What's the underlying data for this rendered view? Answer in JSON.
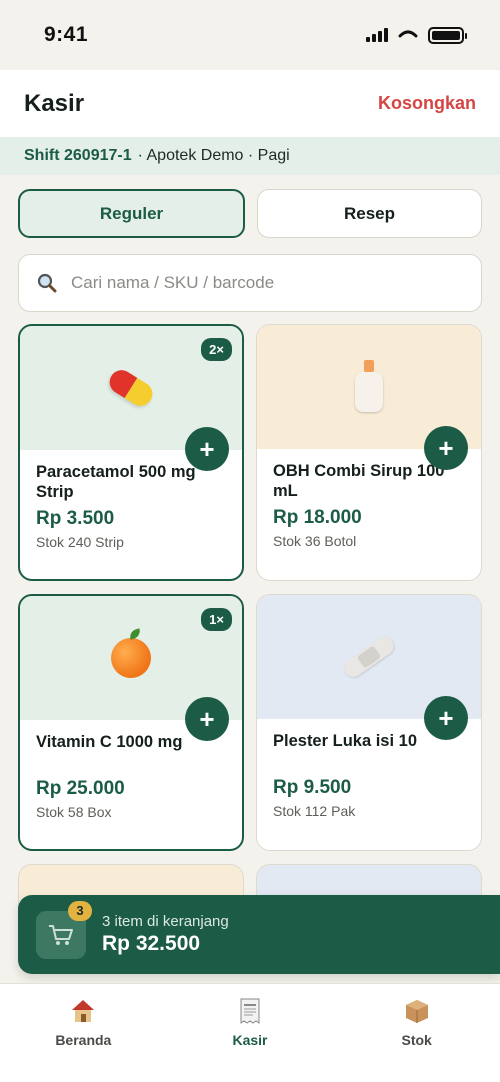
{
  "status_bar": {
    "time": "9:41"
  },
  "header": {
    "title": "Kasir",
    "clear_label": "Kosongkan"
  },
  "shift": {
    "code": "Shift 260917-1",
    "details": "· Apotek Demo · Pagi"
  },
  "mode_tabs": [
    {
      "label": "Reguler",
      "active": true
    },
    {
      "label": "Resep",
      "active": false
    }
  ],
  "search": {
    "placeholder": "Cari nama / SKU / barcode",
    "icon": "search-icon"
  },
  "products": [
    {
      "name": "Paracetamol 500 mg Strip",
      "price": "Rp 3.500",
      "stock": "Stok 240 Strip",
      "qty": "2×",
      "icon": "pill-icon",
      "bg": "#e4efe8"
    },
    {
      "name": "OBH Combi Sirup 100 mL",
      "price": "Rp 18.000",
      "stock": "Stok 36 Botol",
      "qty": "",
      "icon": "bottle-icon",
      "bg": "#f8ecd6"
    },
    {
      "name": "Vitamin C 1000 mg",
      "price": "Rp 25.000",
      "stock": "Stok 58 Box",
      "qty": "1×",
      "icon": "orange-icon",
      "bg": "#e4efe8"
    },
    {
      "name": "Plester Luka isi 10",
      "price": "Rp 9.500",
      "stock": "Stok 112 Pak",
      "qty": "",
      "icon": "bandage-icon",
      "bg": "#e3e9f2"
    }
  ],
  "add_label": "+",
  "cart": {
    "count": "3",
    "summary": "3 item di keranjang",
    "total": "Rp 32.500"
  },
  "tabs": [
    {
      "label": "Beranda",
      "icon": "house-icon",
      "active": false
    },
    {
      "label": "Kasir",
      "icon": "receipt-icon",
      "active": true
    },
    {
      "label": "Stok",
      "icon": "box-icon",
      "active": false
    }
  ],
  "colors": {
    "primary": "#1c5c46",
    "danger": "#d64545",
    "background": "#f4f2ec"
  }
}
